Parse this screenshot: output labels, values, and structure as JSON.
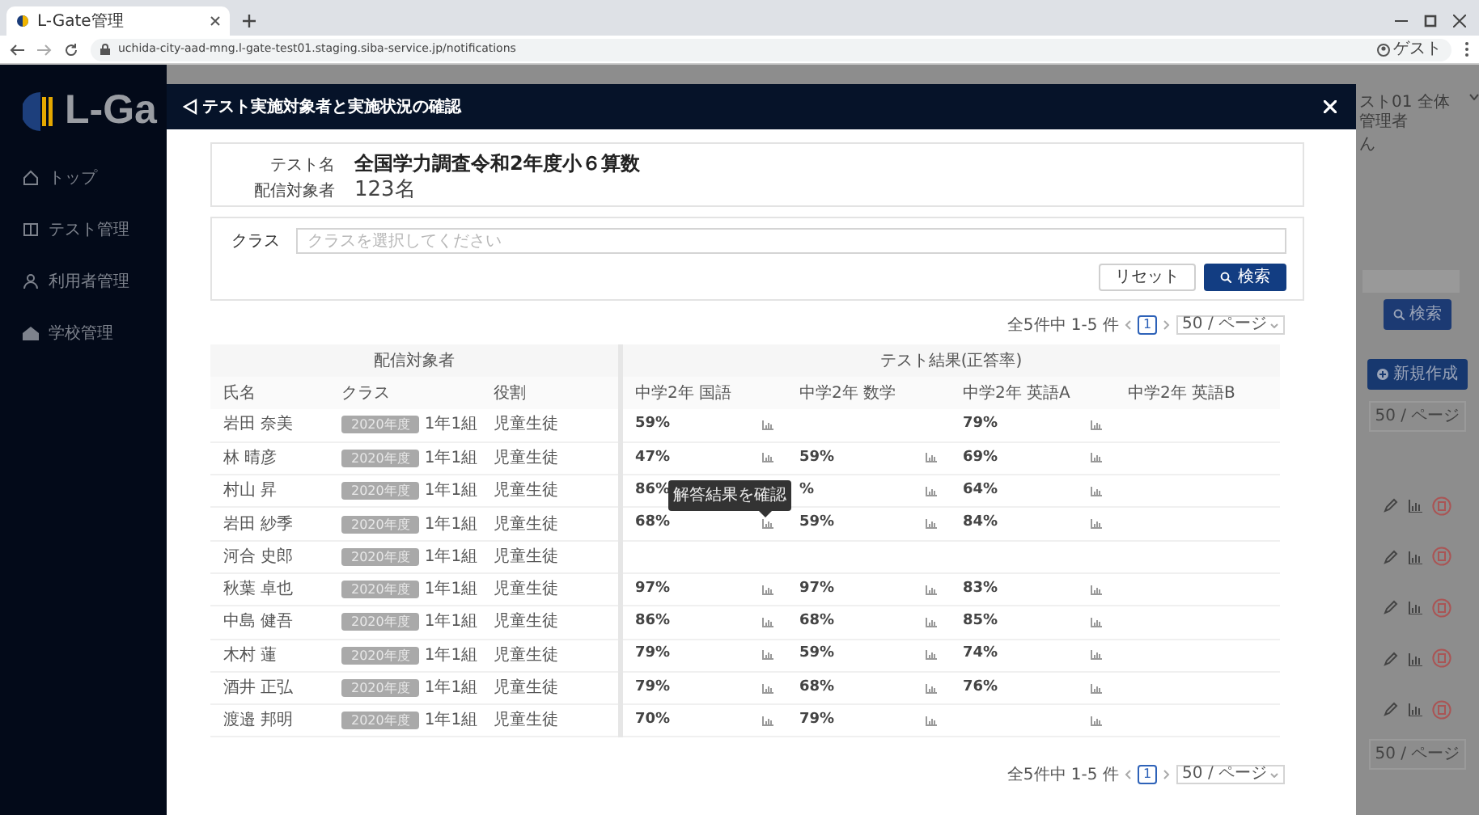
{
  "browser": {
    "tab_title": "L-Gate管理",
    "url": "uchida-city-aad-mng.l-gate-test01.staging.siba-service.jp/notifications",
    "profile": "ゲスト"
  },
  "sidebar": {
    "logo": "L-Ga",
    "items": [
      {
        "label": "トップ",
        "kind": "home"
      },
      {
        "label": "テスト管理",
        "kind": "test"
      },
      {
        "label": "利用者管理",
        "kind": "users"
      },
      {
        "label": "学校管理",
        "kind": "school"
      }
    ]
  },
  "background": {
    "user": "スト01 全体管理者",
    "user_suffix": "ん",
    "search_button": "検索",
    "new_button": "新規作成",
    "per_page": [
      "50 / ページ",
      "50 / ページ"
    ],
    "action_rows": [
      {
        "kind": "actions"
      },
      {
        "kind": "actions"
      },
      {
        "kind": "actions"
      },
      {
        "kind": "actions"
      },
      {
        "kind": "actions"
      }
    ]
  },
  "modal": {
    "title": "テスト実施対象者と実施状況の確認",
    "info": [
      {
        "label": "テスト名",
        "value": "全国学力調査令和2年度小６算数",
        "kind": "title"
      },
      {
        "label": "配信対象者",
        "value": "123名",
        "kind": "count"
      }
    ],
    "filter": {
      "label": "クラス",
      "placeholder": "クラスを選択してください",
      "buttons": [
        {
          "label": "リセット",
          "kind": "secondary"
        },
        {
          "label": "検索",
          "kind": "primary"
        }
      ]
    },
    "pagination_top": {
      "summary": "全5件中 1-5 件",
      "pages": [
        {
          "label": "1",
          "selected": true
        }
      ],
      "per_page": "50 / ページ"
    },
    "table": {
      "groups": [
        {
          "label": "配信対象者"
        },
        {
          "label": "テスト結果(正答率)"
        }
      ],
      "columns": [
        "氏名",
        "クラス",
        "役割",
        "中学2年 国語",
        "中学2年 数学",
        "中学2年 英語A",
        "中学2年 英語B"
      ],
      "rows": [
        {
          "name": "岩田 奈美",
          "class_year": "2020年度",
          "class_name": "1年1組",
          "role": "児童生徒",
          "scores": [
            {
              "value": "59%",
              "chart": true
            },
            {
              "chart": false
            },
            {
              "value": "79%",
              "chart": true
            },
            {
              "chart": false
            }
          ]
        },
        {
          "name": "林 晴彦",
          "class_year": "2020年度",
          "class_name": "1年1組",
          "role": "児童生徒",
          "scores": [
            {
              "value": "47%",
              "chart": true
            },
            {
              "value": "59%",
              "chart": true
            },
            {
              "value": "69%",
              "chart": true
            },
            {
              "chart": false
            }
          ]
        },
        {
          "name": "村山 昇",
          "class_year": "2020年度",
          "class_name": "1年1組",
          "role": "児童生徒",
          "scores": [
            {
              "value": "86%",
              "chart": false
            },
            {
              "value": "%",
              "chart": true
            },
            {
              "value": "64%",
              "chart": true
            },
            {
              "chart": false
            }
          ]
        },
        {
          "name": "岩田 紗季",
          "class_year": "2020年度",
          "class_name": "1年1組",
          "role": "児童生徒",
          "scores": [
            {
              "value": "68%",
              "chart": true,
              "tooltip": "解答結果を確認"
            },
            {
              "value": "59%",
              "chart": true
            },
            {
              "value": "84%",
              "chart": true
            },
            {
              "chart": false
            }
          ]
        },
        {
          "name": "河合 史郎",
          "class_year": "2020年度",
          "class_name": "1年1組",
          "role": "児童生徒",
          "scores": [
            {
              "chart": false
            },
            {
              "chart": false
            },
            {
              "chart": false
            },
            {
              "chart": false
            }
          ]
        },
        {
          "name": "秋葉 卓也",
          "class_year": "2020年度",
          "class_name": "1年1組",
          "role": "児童生徒",
          "scores": [
            {
              "value": "97%",
              "chart": true
            },
            {
              "value": "97%",
              "chart": true
            },
            {
              "value": "83%",
              "chart": true
            },
            {
              "chart": false
            }
          ]
        },
        {
          "name": "中島 健吾",
          "class_year": "2020年度",
          "class_name": "1年1組",
          "role": "児童生徒",
          "scores": [
            {
              "value": "86%",
              "chart": true
            },
            {
              "value": "68%",
              "chart": true
            },
            {
              "value": "85%",
              "chart": true
            },
            {
              "chart": false
            }
          ]
        },
        {
          "name": "木村 蓮",
          "class_year": "2020年度",
          "class_name": "1年1組",
          "role": "児童生徒",
          "scores": [
            {
              "value": "79%",
              "chart": true
            },
            {
              "value": "59%",
              "chart": true
            },
            {
              "value": "74%",
              "chart": true
            },
            {
              "chart": false
            }
          ]
        },
        {
          "name": "酒井 正弘",
          "class_year": "2020年度",
          "class_name": "1年1組",
          "role": "児童生徒",
          "scores": [
            {
              "value": "79%",
              "chart": true
            },
            {
              "value": "68%",
              "chart": true
            },
            {
              "value": "76%",
              "chart": true
            },
            {
              "chart": false
            }
          ]
        },
        {
          "name": "渡邉 邦明",
          "class_year": "2020年度",
          "class_name": "1年1組",
          "role": "児童生徒",
          "scores": [
            {
              "value": "70%",
              "chart": true
            },
            {
              "value": "79%",
              "chart": true
            },
            {
              "chart": true
            },
            {
              "chart": false
            }
          ]
        }
      ]
    },
    "pagination_bottom": {
      "summary": "全5件中 1-5 件",
      "pages": [
        {
          "label": "1",
          "selected": true
        }
      ],
      "per_page": "50 / ページ"
    }
  }
}
